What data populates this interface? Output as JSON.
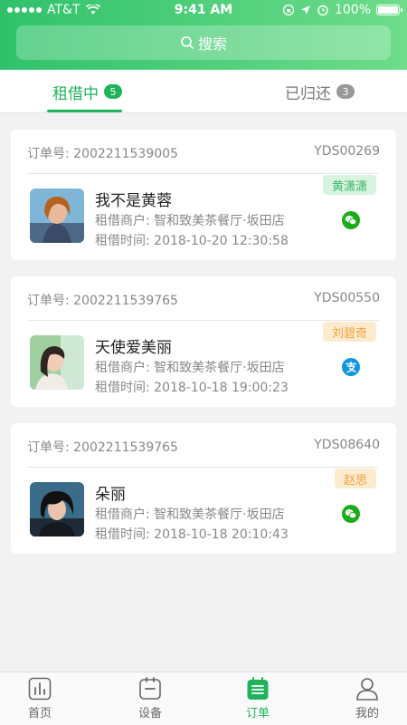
{
  "status_bar": {
    "carrier": "AT&T",
    "time": "9:41 AM",
    "battery": "100%"
  },
  "search": {
    "label": "搜索"
  },
  "tabs": [
    {
      "label": "租借中",
      "count": "5",
      "active": true
    },
    {
      "label": "已归还",
      "count": "3",
      "active": false
    }
  ],
  "orders": [
    {
      "order_label": "订单号: 2002211539005",
      "device_id": "YDS00269",
      "staff": "黄潇潇",
      "staff_color": "#3ab867",
      "user_name": "我不是黄蓉",
      "merchant": "租借商户: 智和致美茶餐厅·坂田店",
      "time": "租借时间: 2018-10-20  12:30:58",
      "payment_icon": "wechat-pay-icon"
    },
    {
      "order_label": "订单号: 2002211539765",
      "device_id": "YDS00550",
      "staff": "刘碧奇",
      "staff_color": "#f0a23b",
      "user_name": "天使爱美丽",
      "merchant": "租借商户: 智和致美茶餐厅·坂田店",
      "time": "租借时间: 2018-10-18  19:00:23",
      "payment_icon": "alipay-icon"
    },
    {
      "order_label": "订单号: 2002211539765",
      "device_id": "YDS08640",
      "staff": "赵思",
      "staff_color": "#f0a23b",
      "user_name": "朵丽",
      "merchant": "租借商户: 智和致美茶餐厅·坂田店",
      "time": "租借时间: 2018-10-18  20:10:43",
      "payment_icon": "wechat-pay-icon"
    }
  ],
  "bottom_nav": [
    {
      "label": "首页",
      "icon": "chart-icon",
      "active": false
    },
    {
      "label": "设备",
      "icon": "device-icon",
      "active": false
    },
    {
      "label": "订单",
      "icon": "order-icon",
      "active": true
    },
    {
      "label": "我的",
      "icon": "profile-icon",
      "active": false
    }
  ],
  "colors": {
    "primary": "#21b35c",
    "wechat": "#1aad19",
    "alipay": "#1296db"
  }
}
